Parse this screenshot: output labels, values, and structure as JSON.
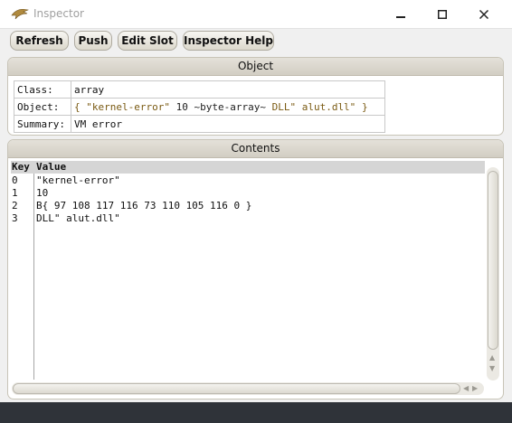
{
  "window": {
    "title": "Inspector",
    "app_icon": "factor-raptor-icon",
    "controls": [
      "minimize-icon",
      "maximize-icon",
      "close-icon"
    ]
  },
  "toolbar": {
    "refresh_label": "Refresh",
    "push_label": "Push",
    "edit_slot_label": "Edit Slot",
    "inspector_help_label": "Inspector Help"
  },
  "object_panel": {
    "header": "Object",
    "rows": [
      {
        "label": "Class:",
        "value": "array"
      },
      {
        "label": "Object:",
        "value_parts": [
          "{",
          "\"kernel-error\"",
          "10",
          "~byte-array~",
          "DLL\"",
          "alut.dll\"",
          "}"
        ]
      },
      {
        "label": "Summary:",
        "value": "VM error"
      }
    ]
  },
  "contents_panel": {
    "header": "Contents",
    "columns": [
      "Key",
      "Value"
    ],
    "rows": [
      {
        "key": "0",
        "value": "\"kernel-error\""
      },
      {
        "key": "1",
        "value": "10"
      },
      {
        "key": "2",
        "value": "B{ 97 108 117 116 73 110 105 116 0 }"
      },
      {
        "key": "3",
        "value": "DLL\" alut.dll\""
      }
    ]
  },
  "colors": {
    "title_text": "#a0a0a0",
    "button_border": "#aeaa9f",
    "panel_header": "#d9d5cb",
    "string_token": "#7a5a12",
    "status_bar": "#2f3339"
  }
}
